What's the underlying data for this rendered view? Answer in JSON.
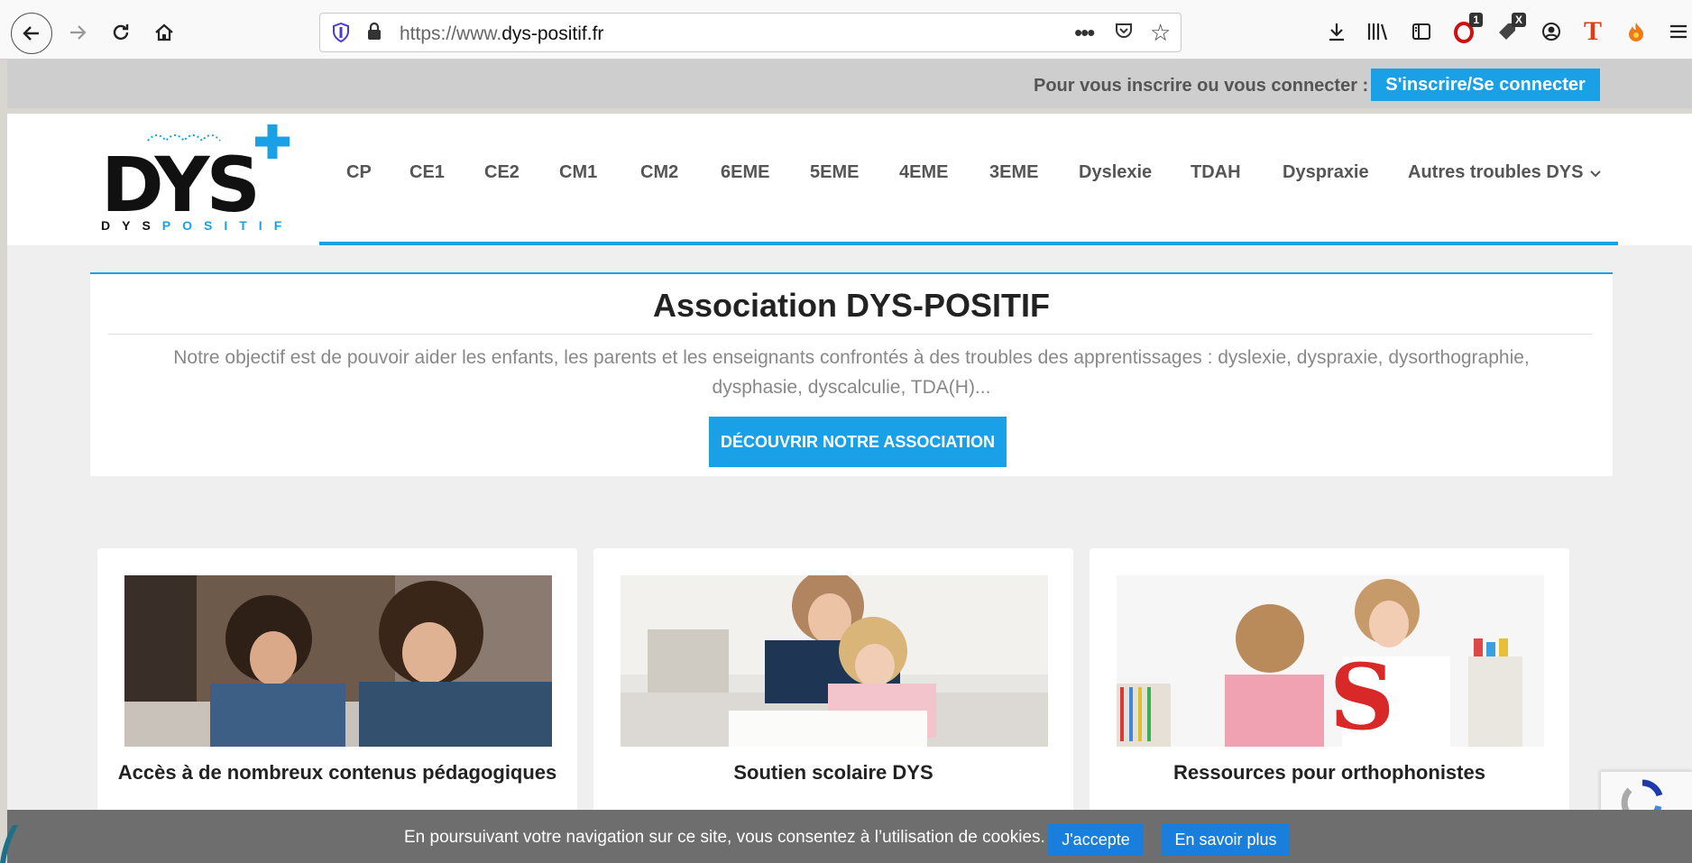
{
  "browser": {
    "url_prefix": "https://www.",
    "url_domain": "dys-positif.fr",
    "badge_count": "1",
    "badge_x": "X"
  },
  "topbar": {
    "prompt": "Pour vous inscrire ou vous connecter :",
    "login_label": "S'inscrire/Se connecter"
  },
  "logo": {
    "big": "DYS",
    "small_dark": "DYS",
    "small_blue": "POSITIF"
  },
  "nav": {
    "items": [
      "CP",
      "CE1",
      "CE2",
      "CM1",
      "CM2",
      "6EME",
      "5EME",
      "4EME",
      "3EME",
      "Dyslexie",
      "TDAH",
      "Dyspraxie",
      "Autres troubles DYS"
    ]
  },
  "association": {
    "title": "Association DYS-POSITIF",
    "description": "Notre objectif est de pouvoir aider les enfants, les parents et les enseignants confrontés à des troubles des apprentissages : dyslexie, dyspraxie, dysorthographie, dysphasie, dyscalculie, TDA(H)...",
    "button_label": "DÉCOUVRIR NOTRE ASSOCIATION"
  },
  "cards": [
    {
      "title": "Accès à de nombreux contenus pédagogiques"
    },
    {
      "title": "Soutien scolaire DYS"
    },
    {
      "title": "Ressources pour orthophonistes"
    }
  ],
  "cookie": {
    "text": "En poursuivant votre navigation sur ce site, vous consentez à l’utilisation de cookies.",
    "accept_label": "J'accepte",
    "more_label": "En savoir plus"
  },
  "colors": {
    "accent": "#1aa0e6",
    "cookie_bg": "#6e6e6e",
    "cookie_button": "#1a7fdc"
  }
}
